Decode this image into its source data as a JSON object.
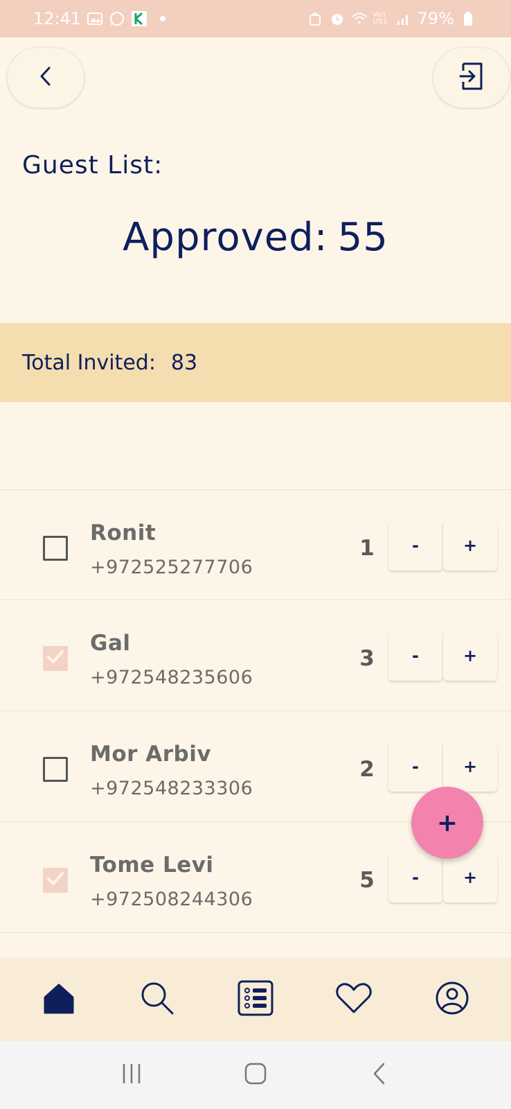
{
  "status_bar": {
    "time": "12:41",
    "battery": "79%",
    "network": "Vo)) LTE1"
  },
  "header": {
    "back_icon": "chevron-left-icon",
    "exit_icon": "logout-icon"
  },
  "page": {
    "title": "Guest List:",
    "approved_label": "Approved:",
    "approved_count": "55",
    "total_label": "Total Invited:",
    "total_count": "83"
  },
  "guests": [
    {
      "name": "Ronit",
      "phone": "+972525277706",
      "count": "1",
      "checked": false
    },
    {
      "name": "Gal",
      "phone": "+972548235606",
      "count": "3",
      "checked": true
    },
    {
      "name": "Mor Arbiv",
      "phone": "+972548233306",
      "count": "2",
      "checked": false
    },
    {
      "name": "Tome Levi",
      "phone": "+972508244306",
      "count": "5",
      "checked": true
    }
  ],
  "stepper": {
    "minus": "-",
    "plus": "+"
  },
  "fab": {
    "label": "+"
  },
  "bottom_nav": {
    "items": [
      {
        "icon": "home-icon",
        "active": true
      },
      {
        "icon": "search-icon",
        "active": false
      },
      {
        "icon": "list-icon",
        "active": false
      },
      {
        "icon": "heart-icon",
        "active": false
      },
      {
        "icon": "profile-icon",
        "active": false
      }
    ]
  },
  "colors": {
    "accent": "#0f1f5c",
    "status_bar": "#f3cfc0",
    "band": "#f4ddaf",
    "fab": "#f383ad",
    "checked": "#f3d3c5"
  }
}
